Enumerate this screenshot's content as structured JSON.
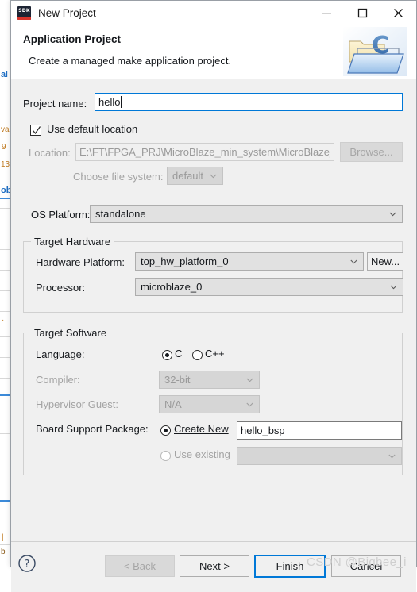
{
  "window": {
    "title": "New Project",
    "app_icon": "sdk-icon",
    "icon_label": "SDK",
    "controls": {
      "minimize": "minimize-icon",
      "maximize": "maximize-icon",
      "close": "close-icon"
    }
  },
  "header": {
    "title": "Application Project",
    "description": "Create a managed make application project.",
    "icon": "c-project-folder-icon"
  },
  "form": {
    "project_name_label": "Project name:",
    "project_name_value": "hello",
    "use_default_location_label": "Use default location",
    "use_default_location_checked": true,
    "location_label": "Location:",
    "location_value": "E:\\FT\\FPGA_PRJ\\MicroBlaze_min_system\\MicroBlaze_mi",
    "browse_label": "Browse...",
    "choose_file_system_label": "Choose file system:",
    "choose_file_system_value": "default",
    "os_platform_label": "OS Platform:",
    "os_platform_value": "standalone"
  },
  "target_hardware": {
    "group_title": "Target Hardware",
    "hardware_platform_label": "Hardware Platform:",
    "hardware_platform_value": "top_hw_platform_0",
    "new_button_label": "New...",
    "processor_label": "Processor:",
    "processor_value": "microblaze_0"
  },
  "target_software": {
    "group_title": "Target Software",
    "language_label": "Language:",
    "language_c_label": "C",
    "language_cpp_label": "C++",
    "language_selected": "C",
    "compiler_label": "Compiler:",
    "compiler_value": "32-bit",
    "hypervisor_label": "Hypervisor Guest:",
    "hypervisor_value": "N/A",
    "bsp_label": "Board Support Package:",
    "bsp_create_new_label": "Create New",
    "bsp_create_new_value": "hello_bsp",
    "bsp_use_existing_label": "Use existing",
    "bsp_use_existing_value": "",
    "bsp_selected": "Create New"
  },
  "footer": {
    "help_icon": "help-icon",
    "back_label": "< Back",
    "next_label": "Next >",
    "finish_label": "Finish",
    "cancel_label": "Cancel"
  },
  "background": {
    "tab_fragment": "al",
    "fragments": [
      "va",
      "9",
      "13"
    ],
    "tab_fragment2": "ob",
    "fragment_bottom": "b"
  },
  "watermark": "CSDN @Bigbee_i",
  "colors": {
    "accent": "#0078d7",
    "title_text": "#16191d",
    "disabled_text": "#9a9a9a",
    "dialog_bg": "#f0f0f0",
    "sdk_navy": "#1d2433",
    "sdk_red": "#d8332a"
  }
}
